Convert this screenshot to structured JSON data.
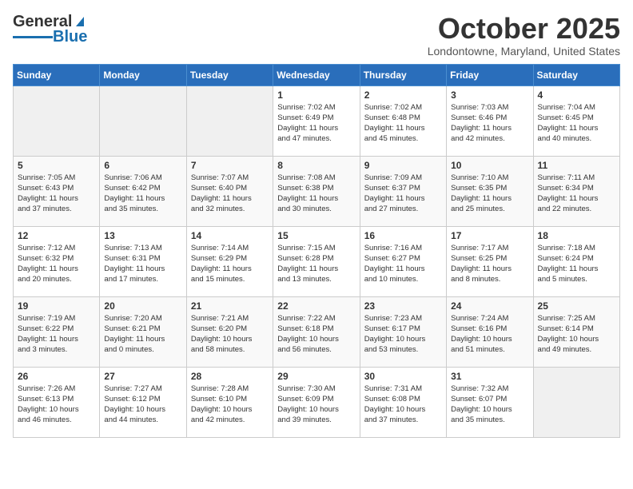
{
  "header": {
    "logo_general": "General",
    "logo_blue": "Blue",
    "month_year": "October 2025",
    "location": "Londontowne, Maryland, United States"
  },
  "weekdays": [
    "Sunday",
    "Monday",
    "Tuesday",
    "Wednesday",
    "Thursday",
    "Friday",
    "Saturday"
  ],
  "weeks": [
    [
      {
        "day": "",
        "info": ""
      },
      {
        "day": "",
        "info": ""
      },
      {
        "day": "",
        "info": ""
      },
      {
        "day": "1",
        "info": "Sunrise: 7:02 AM\nSunset: 6:49 PM\nDaylight: 11 hours\nand 47 minutes."
      },
      {
        "day": "2",
        "info": "Sunrise: 7:02 AM\nSunset: 6:48 PM\nDaylight: 11 hours\nand 45 minutes."
      },
      {
        "day": "3",
        "info": "Sunrise: 7:03 AM\nSunset: 6:46 PM\nDaylight: 11 hours\nand 42 minutes."
      },
      {
        "day": "4",
        "info": "Sunrise: 7:04 AM\nSunset: 6:45 PM\nDaylight: 11 hours\nand 40 minutes."
      }
    ],
    [
      {
        "day": "5",
        "info": "Sunrise: 7:05 AM\nSunset: 6:43 PM\nDaylight: 11 hours\nand 37 minutes."
      },
      {
        "day": "6",
        "info": "Sunrise: 7:06 AM\nSunset: 6:42 PM\nDaylight: 11 hours\nand 35 minutes."
      },
      {
        "day": "7",
        "info": "Sunrise: 7:07 AM\nSunset: 6:40 PM\nDaylight: 11 hours\nand 32 minutes."
      },
      {
        "day": "8",
        "info": "Sunrise: 7:08 AM\nSunset: 6:38 PM\nDaylight: 11 hours\nand 30 minutes."
      },
      {
        "day": "9",
        "info": "Sunrise: 7:09 AM\nSunset: 6:37 PM\nDaylight: 11 hours\nand 27 minutes."
      },
      {
        "day": "10",
        "info": "Sunrise: 7:10 AM\nSunset: 6:35 PM\nDaylight: 11 hours\nand 25 minutes."
      },
      {
        "day": "11",
        "info": "Sunrise: 7:11 AM\nSunset: 6:34 PM\nDaylight: 11 hours\nand 22 minutes."
      }
    ],
    [
      {
        "day": "12",
        "info": "Sunrise: 7:12 AM\nSunset: 6:32 PM\nDaylight: 11 hours\nand 20 minutes."
      },
      {
        "day": "13",
        "info": "Sunrise: 7:13 AM\nSunset: 6:31 PM\nDaylight: 11 hours\nand 17 minutes."
      },
      {
        "day": "14",
        "info": "Sunrise: 7:14 AM\nSunset: 6:29 PM\nDaylight: 11 hours\nand 15 minutes."
      },
      {
        "day": "15",
        "info": "Sunrise: 7:15 AM\nSunset: 6:28 PM\nDaylight: 11 hours\nand 13 minutes."
      },
      {
        "day": "16",
        "info": "Sunrise: 7:16 AM\nSunset: 6:27 PM\nDaylight: 11 hours\nand 10 minutes."
      },
      {
        "day": "17",
        "info": "Sunrise: 7:17 AM\nSunset: 6:25 PM\nDaylight: 11 hours\nand 8 minutes."
      },
      {
        "day": "18",
        "info": "Sunrise: 7:18 AM\nSunset: 6:24 PM\nDaylight: 11 hours\nand 5 minutes."
      }
    ],
    [
      {
        "day": "19",
        "info": "Sunrise: 7:19 AM\nSunset: 6:22 PM\nDaylight: 11 hours\nand 3 minutes."
      },
      {
        "day": "20",
        "info": "Sunrise: 7:20 AM\nSunset: 6:21 PM\nDaylight: 11 hours\nand 0 minutes."
      },
      {
        "day": "21",
        "info": "Sunrise: 7:21 AM\nSunset: 6:20 PM\nDaylight: 10 hours\nand 58 minutes."
      },
      {
        "day": "22",
        "info": "Sunrise: 7:22 AM\nSunset: 6:18 PM\nDaylight: 10 hours\nand 56 minutes."
      },
      {
        "day": "23",
        "info": "Sunrise: 7:23 AM\nSunset: 6:17 PM\nDaylight: 10 hours\nand 53 minutes."
      },
      {
        "day": "24",
        "info": "Sunrise: 7:24 AM\nSunset: 6:16 PM\nDaylight: 10 hours\nand 51 minutes."
      },
      {
        "day": "25",
        "info": "Sunrise: 7:25 AM\nSunset: 6:14 PM\nDaylight: 10 hours\nand 49 minutes."
      }
    ],
    [
      {
        "day": "26",
        "info": "Sunrise: 7:26 AM\nSunset: 6:13 PM\nDaylight: 10 hours\nand 46 minutes."
      },
      {
        "day": "27",
        "info": "Sunrise: 7:27 AM\nSunset: 6:12 PM\nDaylight: 10 hours\nand 44 minutes."
      },
      {
        "day": "28",
        "info": "Sunrise: 7:28 AM\nSunset: 6:10 PM\nDaylight: 10 hours\nand 42 minutes."
      },
      {
        "day": "29",
        "info": "Sunrise: 7:30 AM\nSunset: 6:09 PM\nDaylight: 10 hours\nand 39 minutes."
      },
      {
        "day": "30",
        "info": "Sunrise: 7:31 AM\nSunset: 6:08 PM\nDaylight: 10 hours\nand 37 minutes."
      },
      {
        "day": "31",
        "info": "Sunrise: 7:32 AM\nSunset: 6:07 PM\nDaylight: 10 hours\nand 35 minutes."
      },
      {
        "day": "",
        "info": ""
      }
    ]
  ]
}
